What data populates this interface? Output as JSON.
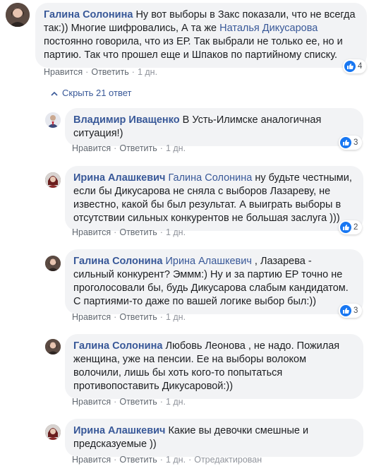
{
  "actions": {
    "like": "Нравится",
    "reply": "Ответить",
    "sep": "·",
    "edited": "Отредактирован"
  },
  "top_comment": {
    "author": "Галина Солонина",
    "text_1": " Ну вот выборы в Закс показали, что не всегда так:)) Многие шифровались, А та же ",
    "mention": "Наталья Дикусарова",
    "text_2": " постоянно говорила, что из ЕР. Так выбрали не только ее, но и партию. Так что прошел еще и Шпаков по партийному списку.",
    "time": "1 дн.",
    "likes": "4"
  },
  "hide_replies": "Скрыть 21 ответ",
  "replies": [
    {
      "author": "Владимир Иващенко",
      "mention": "",
      "text": " В Усть-Илимске аналогичная ситуация!)",
      "time": "1 дн.",
      "likes": "3",
      "edited": ""
    },
    {
      "author": "Ирина Алашкевич",
      "mention": "Галина Солонина",
      "text": " ну будьте честными, если бы Дикусарова не сняла с выборов Лазареву, не известно, какой бы был результат. А выиграть выборы в отсутствии сильных конкурентов не большая заслуга )))",
      "time": "1 дн.",
      "likes": "2",
      "edited": ""
    },
    {
      "author": "Галина Солонина",
      "mention": "Ирина Алашкевич",
      "text": " , Лазарева - сильный конкурент? Эммм:) Ну и за партию ЕР точно не проголосовали бы, будь Дикусарова слабым кандидатом. С партиями-то даже по вашей логике выбор был:))",
      "time": "1 дн.",
      "likes": "3",
      "edited": ""
    },
    {
      "author": "Галина Солонина",
      "mention": "",
      "text": " Любовь Леонова , не надо. Пожилая женщина, уже на пенсии. Ее на выборы волоком волочили, лишь бы хоть кого-то попытаться противопоставить Дикусаровой:))",
      "time": "1 дн.",
      "likes": "",
      "edited": ""
    },
    {
      "author": "Ирина Алашкевич",
      "mention": "",
      "text": " Какие вы девочки смешные и предсказуемые ))",
      "time": "1 дн.",
      "likes": "",
      "edited": "Отредактирован"
    }
  ],
  "colors": {
    "link": "#385898",
    "bubble": "#f2f3f5",
    "like": "#1877f2",
    "meta": "#90949c"
  },
  "icons": {
    "like": "thumbs-up-icon",
    "chevron": "chevron-up-icon"
  }
}
